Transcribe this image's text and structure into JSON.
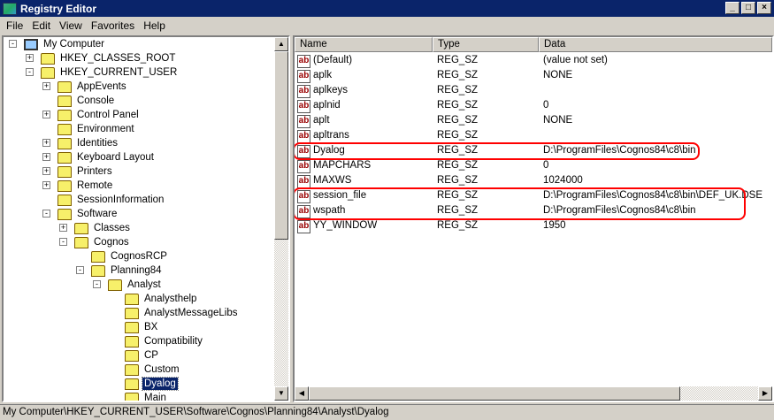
{
  "window": {
    "title": "Registry Editor",
    "minimize": "_",
    "maximize": "□",
    "close": "×"
  },
  "menu": [
    "File",
    "Edit",
    "View",
    "Favorites",
    "Help"
  ],
  "tree": [
    {
      "label": "My Computer",
      "level": 0,
      "exp": "-",
      "icon": "computer"
    },
    {
      "label": "HKEY_CLASSES_ROOT",
      "level": 1,
      "exp": "+"
    },
    {
      "label": "HKEY_CURRENT_USER",
      "level": 1,
      "exp": "-"
    },
    {
      "label": "AppEvents",
      "level": 2,
      "exp": "+"
    },
    {
      "label": "Console",
      "level": 2,
      "exp": ""
    },
    {
      "label": "Control Panel",
      "level": 2,
      "exp": "+"
    },
    {
      "label": "Environment",
      "level": 2,
      "exp": ""
    },
    {
      "label": "Identities",
      "level": 2,
      "exp": "+"
    },
    {
      "label": "Keyboard Layout",
      "level": 2,
      "exp": "+"
    },
    {
      "label": "Printers",
      "level": 2,
      "exp": "+"
    },
    {
      "label": "Remote",
      "level": 2,
      "exp": "+"
    },
    {
      "label": "SessionInformation",
      "level": 2,
      "exp": ""
    },
    {
      "label": "Software",
      "level": 2,
      "exp": "-"
    },
    {
      "label": "Classes",
      "level": 3,
      "exp": "+"
    },
    {
      "label": "Cognos",
      "level": 3,
      "exp": "-"
    },
    {
      "label": "CognosRCP",
      "level": 4,
      "exp": ""
    },
    {
      "label": "Planning84",
      "level": 4,
      "exp": "-"
    },
    {
      "label": "Analyst",
      "level": 5,
      "exp": "-"
    },
    {
      "label": "Analysthelp",
      "level": 6,
      "exp": ""
    },
    {
      "label": "AnalystMessageLibs",
      "level": 6,
      "exp": ""
    },
    {
      "label": "BX",
      "level": 6,
      "exp": ""
    },
    {
      "label": "Compatibility",
      "level": 6,
      "exp": ""
    },
    {
      "label": "CP",
      "level": 6,
      "exp": ""
    },
    {
      "label": "Custom",
      "level": 6,
      "exp": ""
    },
    {
      "label": "Dyalog",
      "level": 6,
      "exp": "",
      "selected": true
    },
    {
      "label": "Main",
      "level": 6,
      "exp": ""
    }
  ],
  "columns": {
    "name": "Name",
    "type": "Type",
    "data": "Data"
  },
  "values": [
    {
      "name": "(Default)",
      "type": "REG_SZ",
      "data": "(value not set)"
    },
    {
      "name": "aplk",
      "type": "REG_SZ",
      "data": "NONE"
    },
    {
      "name": "aplkeys",
      "type": "REG_SZ",
      "data": ""
    },
    {
      "name": "aplnid",
      "type": "REG_SZ",
      "data": "0"
    },
    {
      "name": "aplt",
      "type": "REG_SZ",
      "data": "NONE"
    },
    {
      "name": "apltrans",
      "type": "REG_SZ",
      "data": ""
    },
    {
      "name": "Dyalog",
      "type": "REG_SZ",
      "data": "D:\\ProgramFiles\\Cognos84\\c8\\bin"
    },
    {
      "name": "MAPCHARS",
      "type": "REG_SZ",
      "data": "0"
    },
    {
      "name": "MAXWS",
      "type": "REG_SZ",
      "data": "1024000"
    },
    {
      "name": "session_file",
      "type": "REG_SZ",
      "data": "D:\\ProgramFiles\\Cognos84\\c8\\bin\\DEF_UK.DSE"
    },
    {
      "name": "wspath",
      "type": "REG_SZ",
      "data": "D:\\ProgramFiles\\Cognos84\\c8\\bin"
    },
    {
      "name": "YY_WINDOW",
      "type": "REG_SZ",
      "data": "1950"
    }
  ],
  "value_icon_text": "ab",
  "status": "My Computer\\HKEY_CURRENT_USER\\Software\\Cognos\\Planning84\\Analyst\\Dyalog",
  "highlight_color": "#ff0000"
}
